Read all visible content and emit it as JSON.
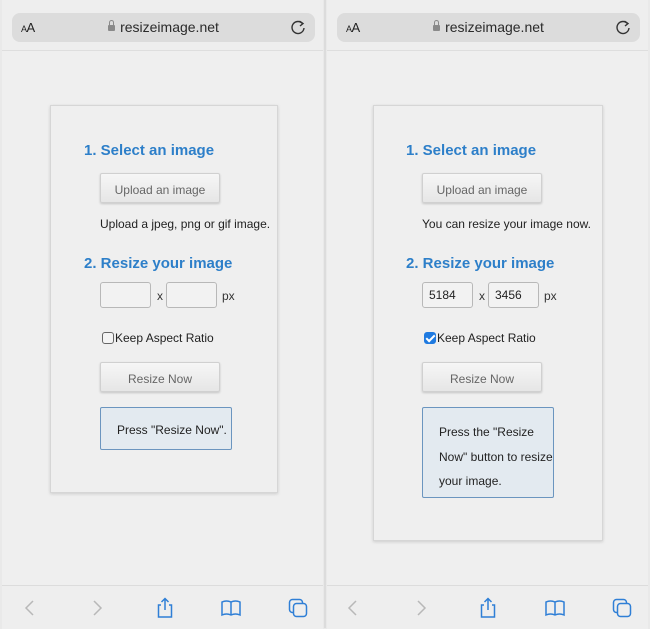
{
  "browser": {
    "text_size_label": "AA",
    "url": "resizeimage.net",
    "icons": {
      "lock": "lock-icon",
      "reload": "reload-icon",
      "back": "chevron-left-icon",
      "forward": "chevron-right-icon",
      "share": "share-icon",
      "bookmarks": "book-icon",
      "tabs": "tabs-icon"
    }
  },
  "screens": [
    {
      "step1_title": "1. Select an image",
      "upload_button": "Upload an image",
      "upload_note": "Upload a jpeg, png or gif image.",
      "step2_title": "2. Resize your image",
      "width_value": "",
      "height_value": "",
      "times_label": "x",
      "unit_label": "px",
      "keep_aspect_label": "Keep Aspect Ratio",
      "keep_aspect_checked": false,
      "resize_button": "Resize Now",
      "message_lines": [
        "Press \"Resize Now\"."
      ]
    },
    {
      "step1_title": "1. Select an image",
      "upload_button": "Upload an image",
      "upload_note": "You can resize your image now.",
      "step2_title": "2. Resize your image",
      "width_value": "5184",
      "height_value": "3456",
      "times_label": "x",
      "unit_label": "px",
      "keep_aspect_label": "Keep Aspect Ratio",
      "keep_aspect_checked": true,
      "resize_button": "Resize Now",
      "message_lines": [
        "Press the \"Resize",
        "Now\" button to resize",
        "your image."
      ]
    }
  ],
  "colors": {
    "accent": "#2d7fc9",
    "checkbox": "#1f7ae0",
    "toolbar_icon": "#2f7fd6",
    "toolbar_disabled": "#b8b8b8",
    "message_border": "#6b95bf"
  }
}
